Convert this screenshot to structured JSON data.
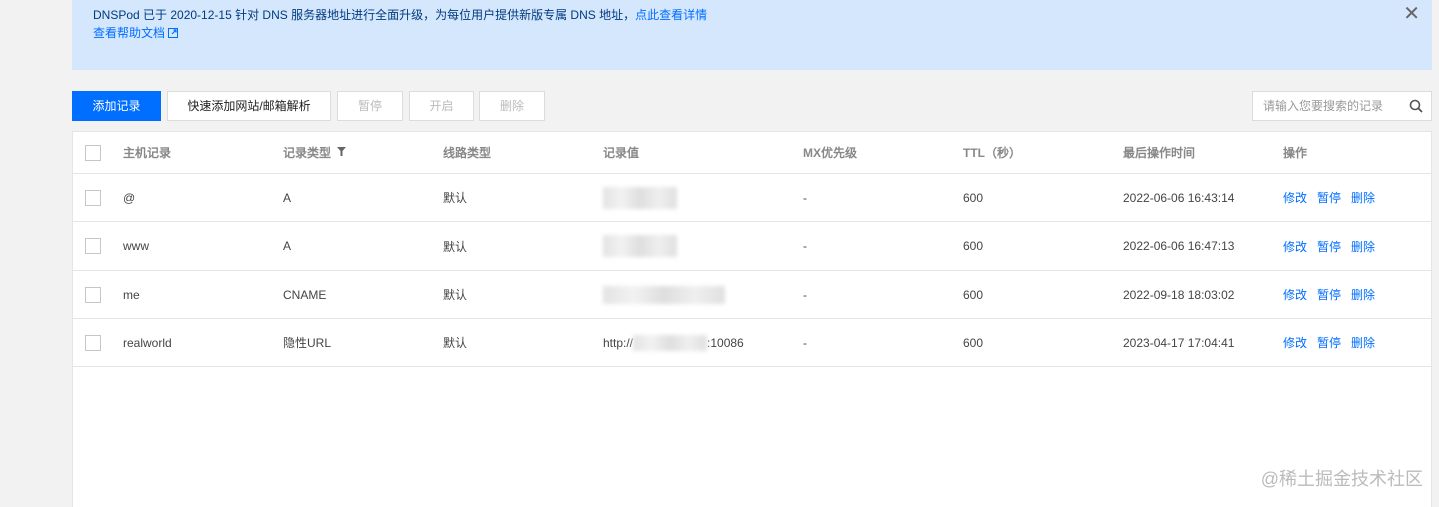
{
  "notice": {
    "message": "DNSPod 已于 2020-12-15 针对 DNS 服务器地址进行全面升级，为每位用户提供新版专属 DNS 地址，",
    "details_link": "点此查看详情",
    "help_link": "查看帮助文档",
    "close": "✕"
  },
  "toolbar": {
    "add_record": "添加记录",
    "quick_add": "快速添加网站/邮箱解析",
    "pause": "暂停",
    "enable": "开启",
    "delete": "删除",
    "search_placeholder": "请输入您要搜索的记录"
  },
  "table": {
    "headers": {
      "host": "主机记录",
      "type": "记录类型",
      "line": "线路类型",
      "value": "记录值",
      "mx": "MX优先级",
      "ttl": "TTL（秒）",
      "time": "最后操作时间",
      "ops": "操作"
    },
    "rows": [
      {
        "host": "@",
        "type": "A",
        "line": "默认",
        "value_prefix": "",
        "value_suffix": "",
        "mx": "-",
        "ttl": "600",
        "time": "2022-06-06 16:43:14"
      },
      {
        "host": "www",
        "type": "A",
        "line": "默认",
        "value_prefix": "",
        "value_suffix": "",
        "mx": "-",
        "ttl": "600",
        "time": "2022-06-06 16:47:13"
      },
      {
        "host": "me",
        "type": "CNAME",
        "line": "默认",
        "value_prefix": "",
        "value_suffix": "",
        "mx": "-",
        "ttl": "600",
        "time": "2022-09-18 18:03:02"
      },
      {
        "host": "realworld",
        "type": "隐性URL",
        "line": "默认",
        "value_prefix": "http://",
        "value_suffix": ":10086",
        "mx": "-",
        "ttl": "600",
        "time": "2023-04-17 17:04:41"
      }
    ],
    "actions": {
      "edit": "修改",
      "pause": "暂停",
      "delete": "删除"
    }
  },
  "watermark": "@稀土掘金技术社区",
  "colors": {
    "accent": "#006eff",
    "notice_bg": "#d5e7fd"
  }
}
